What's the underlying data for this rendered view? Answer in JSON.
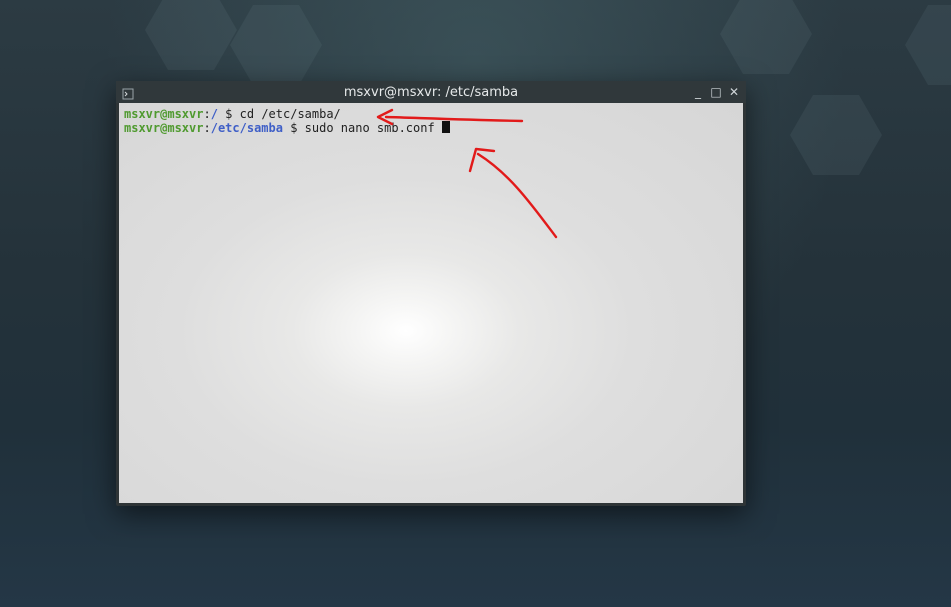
{
  "window": {
    "title": "msxvr@msxvr: /etc/samba",
    "controls": {
      "minimize": "_",
      "maximize": "□",
      "close": "✕"
    }
  },
  "terminal": {
    "lines": [
      {
        "user": "msxvr@msxvr",
        "separator": ":",
        "path": "/",
        "prompt": " $ ",
        "command": "cd /etc/samba/"
      },
      {
        "user": "msxvr@msxvr",
        "separator": ":",
        "path": "/etc/samba",
        "prompt": " $ ",
        "command": "sudo nano smb.conf "
      }
    ]
  },
  "colors": {
    "user": "#4f9a2f",
    "path": "#3f5fc7",
    "annotation": "#e21a1a"
  },
  "icons": {
    "app": "terminal-icon",
    "annotation_arrows": "red-arrow-annotations"
  }
}
